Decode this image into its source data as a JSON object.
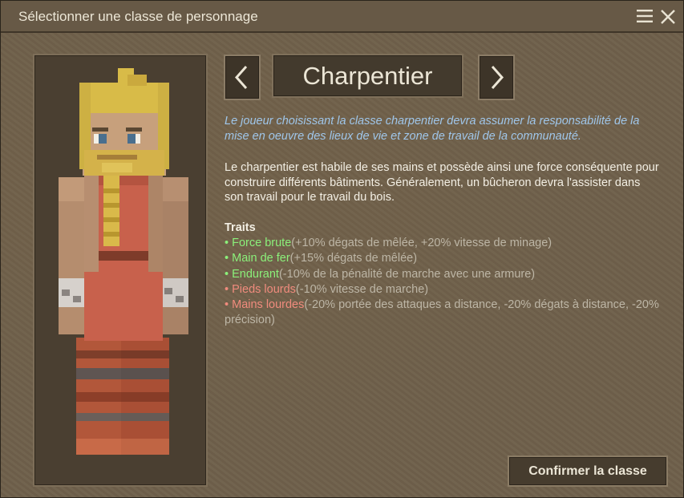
{
  "window": {
    "title": "Sélectionner une classe de personnage"
  },
  "icons": {
    "menu": "hamburger-menu-icon",
    "close": "close-icon",
    "prev": "chevron-left-icon",
    "next": "chevron-right-icon"
  },
  "class_selector": {
    "name": "Charpentier"
  },
  "description": {
    "italic": "Le joueur choisissant la classe charpentier devra assumer la responsabilité de la mise en oeuvre des lieux de vie et zone de travail de la communauté.",
    "main": "Le charpentier est habile de ses mains et possède ainsi une force conséquente pour construire différents bâtiments. Généralement, un bûcheron devra l'assister dans son travail pour le travail du bois."
  },
  "traits": {
    "title": "Traits",
    "bullet": "•",
    "items": [
      {
        "name": "Force brute",
        "effect": "(+10% dégats de mêlée, +20% vitesse de minage)",
        "kind": "positive"
      },
      {
        "name": "Main de fer",
        "effect": "(+15% dégats de mêlée)",
        "kind": "positive"
      },
      {
        "name": "Endurant",
        "effect": "(-10% de la pénalité de marche avec une armure)",
        "kind": "positive"
      },
      {
        "name": "Pieds lourds",
        "effect": "(-10% vitesse de marche)",
        "kind": "negative"
      },
      {
        "name": "Mains lourdes",
        "effect": "(-20% portée des attaques a distance, -20% dégats à distance, -20% précision)",
        "kind": "negative"
      }
    ]
  },
  "confirm_button": {
    "label": "Confirmer la classe"
  },
  "colors": {
    "positive_trait": "#8bf07a",
    "negative_trait": "#f08b7d",
    "italic_text": "#9fc6ea",
    "panel_background": "#6f604b"
  }
}
